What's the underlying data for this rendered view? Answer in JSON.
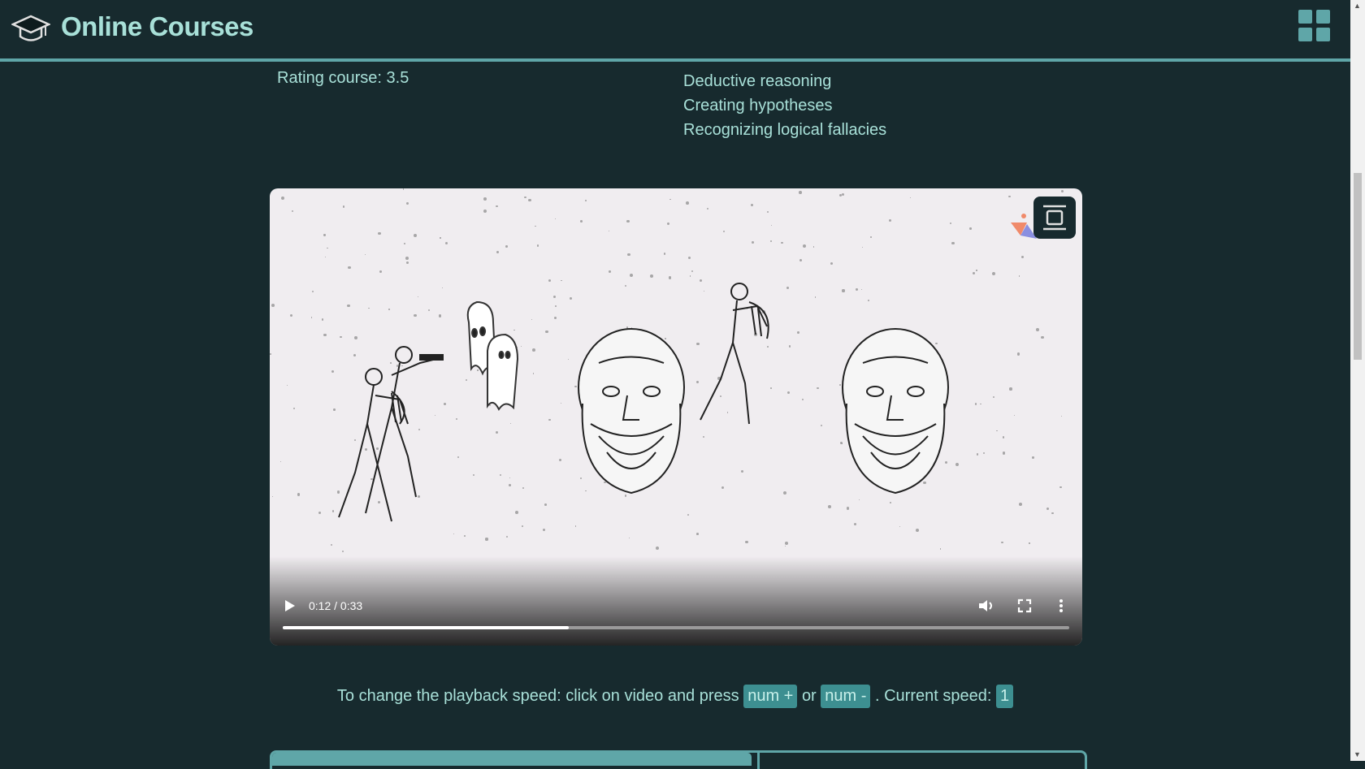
{
  "header": {
    "title": "Online Courses",
    "logo_icon": "graduation-cap-icon",
    "menu_icon": "grid-apps-icon",
    "accent": "#5fa6a8"
  },
  "course": {
    "rating_label": "Rating course: 3.5",
    "skills": [
      "Deductive reasoning",
      "Creating hypotheses",
      "Recognizing logical fallacies"
    ]
  },
  "video": {
    "time": "0:12 / 0:33",
    "progress": 0.364,
    "icons": [
      "play-icon",
      "volume-icon",
      "fullscreen-icon",
      "more-options-icon",
      "picture-in-picture-icon"
    ]
  },
  "speed_hint": {
    "prefix": "To change the playback speed: click on video and press",
    "key_plus": "num +",
    "or": "or",
    "key_minus": "num -",
    "suffix": ". Current speed:",
    "current_speed": "1"
  },
  "colors": {
    "background": "#172a2e",
    "text": "#a8e0d8",
    "key_bg": "#3d8f91"
  }
}
